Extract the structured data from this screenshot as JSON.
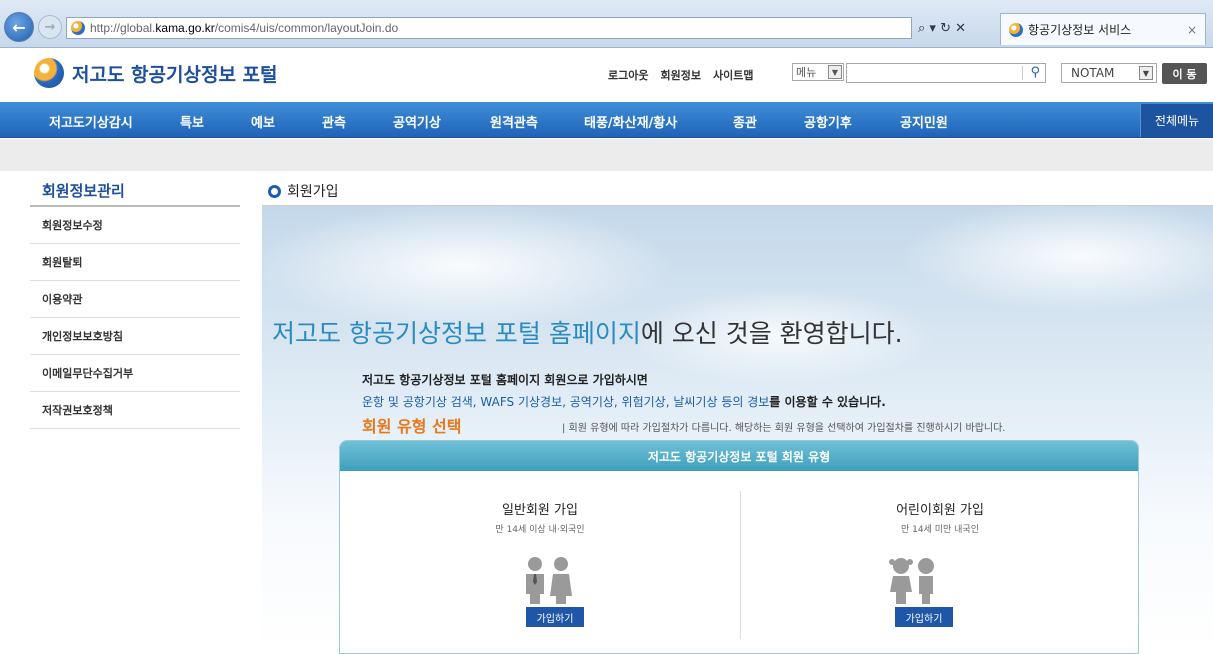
{
  "browser": {
    "url_prefix": "http://global.",
    "url_host": "kama.go.kr",
    "url_path": "/comis4/uis/common/layoutJoin.do",
    "addr_icons": "⌕ ▾ ↻ ✕",
    "tab_title": "항공기상정보 서비스",
    "tab_close": "×"
  },
  "header": {
    "logo_text": "저고도 항공기상정보 포털",
    "util_links": [
      "로그아웃",
      "회원정보",
      "사이트맵"
    ],
    "menu_select": "메뉴",
    "notam_select": "NOTAM",
    "go_button": "이 동"
  },
  "gnb": {
    "items": [
      "저고도기상감시",
      "특보",
      "예보",
      "관측",
      "공역기상",
      "원격관측",
      "태풍/화산재/황사",
      "종관",
      "공항기후",
      "공지민원"
    ],
    "all_menu": "전체메뉴"
  },
  "sidebar": {
    "title": "회원정보관리",
    "items": [
      "회원정보수정",
      "회원탈퇴",
      "이용약관",
      "개인정보보호방침",
      "이메일무단수집거부",
      "저작권보호정책"
    ]
  },
  "content": {
    "heading": "회원가입",
    "welcome_hl": "저고도 항공기상정보 포털 홈페이지",
    "welcome_rest": "에 오신 것을 환영합니다.",
    "intro1": "저고도 항공기상정보 포털 홈페이지 회원으로 가입하시면",
    "intro2_a": "운항 및 공항기상 검색, WAFS 기상경보, 공역기상, 위험기상, 날씨기상 등의 경보",
    "intro2_b": "를 이용할 수 있습니다.",
    "type_label": "회원 유형 선택",
    "type_desc": "| 회원 유형에 따라 가입절차가 다릅니다. 해당하는 회원 유형을 선택하여 가입절차를 진행하시기 바랍니다.",
    "box_title": "저고도 항공기상정보 포털 회원 유형",
    "general": {
      "title": "일반회원 가입",
      "sub": "만 14세 이상 내·외국인",
      "button": "가입하기"
    },
    "child": {
      "title": "어린이회원 가입",
      "sub": "만 14세 미만 내국인",
      "button": "가입하기"
    }
  }
}
